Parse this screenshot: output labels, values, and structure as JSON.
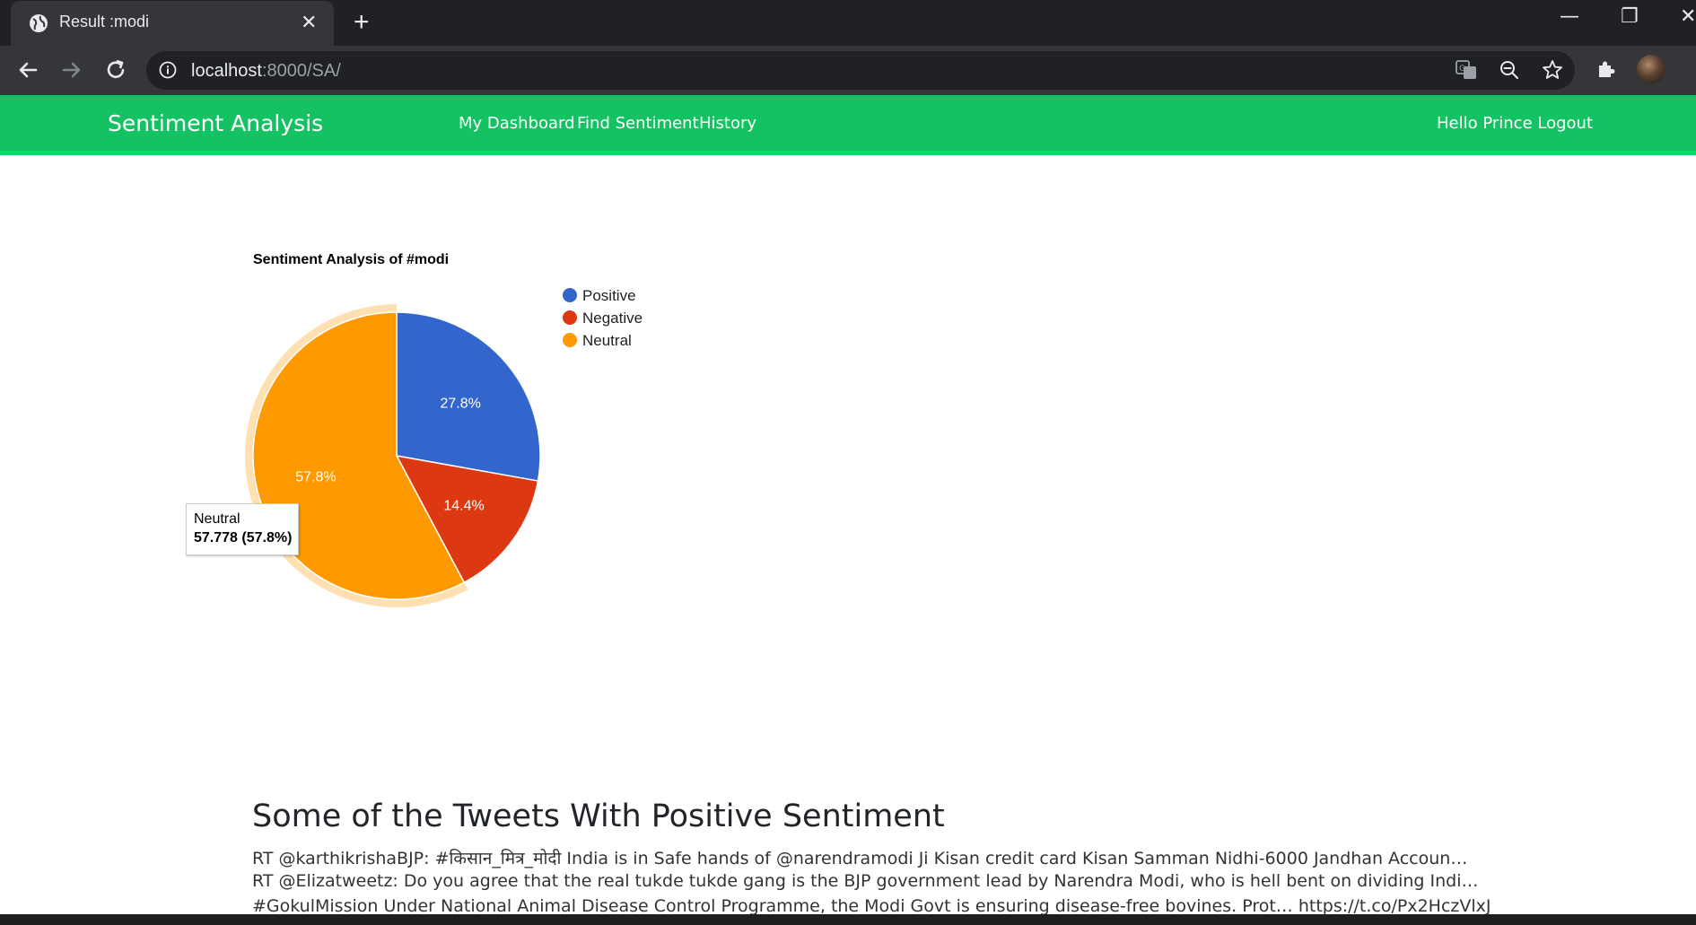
{
  "browser": {
    "tab_title": "Result :modi",
    "tab_close": "✕",
    "new_tab": "+",
    "url_host": "localhost",
    "url_path": ":8000/SA/",
    "window_controls": {
      "minimize": "—",
      "restore": "❐",
      "close": "✕"
    }
  },
  "navbar": {
    "brand": "Sentiment Analysis",
    "links": [
      "My Dashboard",
      "Find Sentiment",
      "History"
    ],
    "greeting": "Hello Prince Logout",
    "background": "#14c263"
  },
  "chart_data": {
    "type": "pie",
    "title": "Sentiment Analysis of #modi",
    "legend_position": "right",
    "labels": [
      "Positive",
      "Negative",
      "Neutral"
    ],
    "values": [
      27.8,
      14.4,
      57.778
    ],
    "percent_labels": [
      "27.8%",
      "14.4%",
      "57.8%"
    ],
    "colors": [
      "#3366cc",
      "#dc3912",
      "#ff9900"
    ],
    "highlighted": "Neutral",
    "tooltip": {
      "label": "Neutral",
      "value": "57.778 (57.8%)"
    }
  },
  "tweets": {
    "heading": "Some of the Tweets With Positive Sentiment",
    "items": [
      "RT @karthikrishaBJP: #किसान_मित्र_मोदी India is in Safe hands of @narendramodi Ji Kisan credit card Kisan Samman Nidhi-6000 Jandhan Accoun…",
      "RT @Elizatweetz: Do you agree that the real tukde tukde gang is the BJP government lead by Narendra Modi, who is hell bent on dividing Indi…",
      "#GokulMission Under National Animal Disease Control Programme, the Modi Govt is ensuring disease-free bovines. Prot… https://t.co/Px2HczVlxJ"
    ]
  }
}
